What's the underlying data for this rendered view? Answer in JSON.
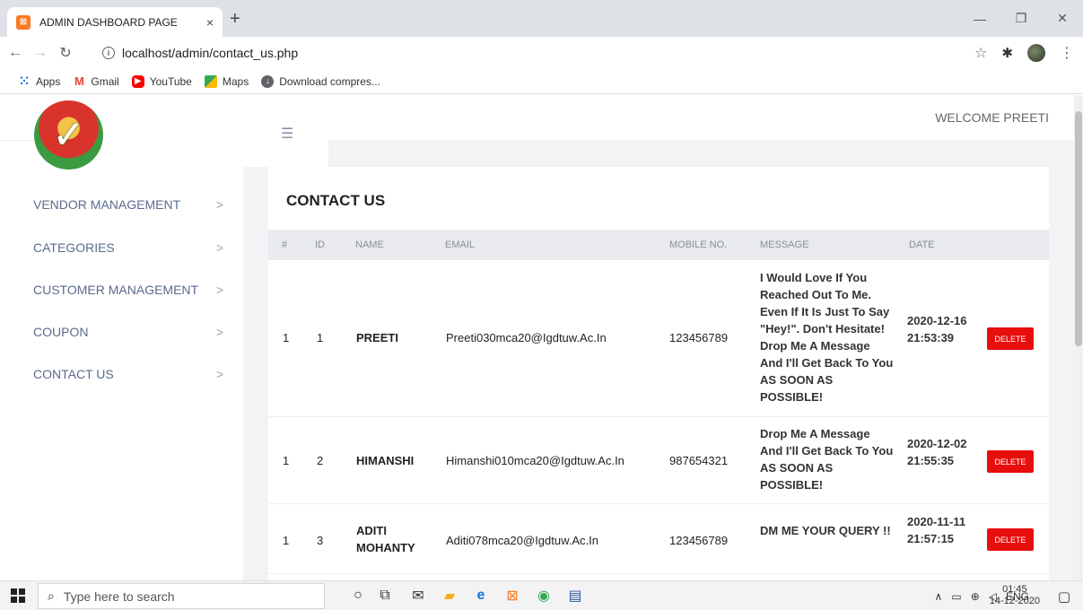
{
  "browser": {
    "tab_title": "ADMIN DASHBOARD PAGE",
    "tab_close": "×",
    "new_tab": "+",
    "url": "localhost/admin/contact_us.php",
    "bookmarks": [
      {
        "label": "Apps",
        "icon": "apps-icon"
      },
      {
        "label": "Gmail",
        "icon": "gmail-icon"
      },
      {
        "label": "YouTube",
        "icon": "youtube-icon"
      },
      {
        "label": "Maps",
        "icon": "maps-icon"
      },
      {
        "label": "Download compres...",
        "icon": "download-icon"
      }
    ]
  },
  "header": {
    "welcome": "WELCOME PREETI"
  },
  "sidebar": {
    "items": [
      {
        "label": "VENDOR MANAGEMENT"
      },
      {
        "label": "CATEGORIES"
      },
      {
        "label": "CUSTOMER MANAGEMENT"
      },
      {
        "label": "COUPON"
      },
      {
        "label": "CONTACT US"
      }
    ]
  },
  "main": {
    "title": "CONTACT US",
    "columns": [
      "#",
      "ID",
      "NAME",
      "EMAIL",
      "MOBILE NO.",
      "MESSAGE",
      "DATE"
    ],
    "delete_label": "DELETE",
    "rows": [
      {
        "num": "1",
        "id": "1",
        "name": "PREETI",
        "email": "Preeti030mca20@Igdtuw.Ac.In",
        "mobile": "123456789",
        "message": "I Would Love If You Reached Out To Me. Even If It Is Just To Say \"Hey!\". Don't Hesitate! Drop Me A Message And I'll Get Back To You AS SOON AS POSSIBLE!",
        "date": "2020-12-16 21:53:39"
      },
      {
        "num": "1",
        "id": "2",
        "name": "HIMANSHI",
        "email": "Himanshi010mca20@Igdtuw.Ac.In",
        "mobile": "987654321",
        "message": "Drop Me A Message And I'll Get Back To You AS SOON AS POSSIBLE!",
        "date": "2020-12-02 21:55:35"
      },
      {
        "num": "1",
        "id": "3",
        "name": "ADITI MOHANTY",
        "email": "Aditi078mca20@Igdtuw.Ac.In",
        "mobile": "123456789",
        "message": "DM ME YOUR QUERY !!",
        "date": "2020-11-11 21:57:15"
      }
    ]
  },
  "taskbar": {
    "search_placeholder": "Type here to search",
    "language": "ENG",
    "time": "01:45",
    "date": "14-12-2020"
  }
}
